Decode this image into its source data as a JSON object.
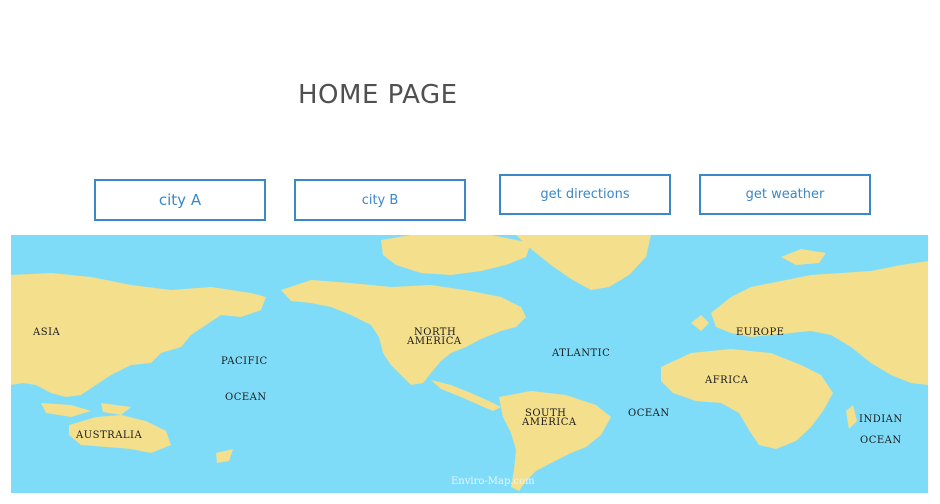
{
  "page": {
    "title": "HOME PAGE"
  },
  "buttons": {
    "city_a": "city A",
    "city_b": "city B",
    "get_directions": "get directions",
    "get_weather": "get weather"
  },
  "map": {
    "labels": {
      "asia": "ASIA",
      "pacific": "PACIFIC",
      "pacific_ocean": "OCEAN",
      "north_america_1": "NORTH",
      "north_america_2": "AMERICA",
      "atlantic": "ATLANTIC",
      "atlantic_ocean": "OCEAN",
      "europe": "EUROPE",
      "africa": "AFRICA",
      "south_america_1": "SOUTH",
      "south_america_2": "AMERICA",
      "australia": "AUSTRALIA",
      "indian": "INDIAN",
      "indian_ocean": "OCEAN"
    },
    "watermark": "Enviro-Map.com",
    "colors": {
      "ocean": "#7fdcf9",
      "land": "#f3df8c"
    }
  }
}
